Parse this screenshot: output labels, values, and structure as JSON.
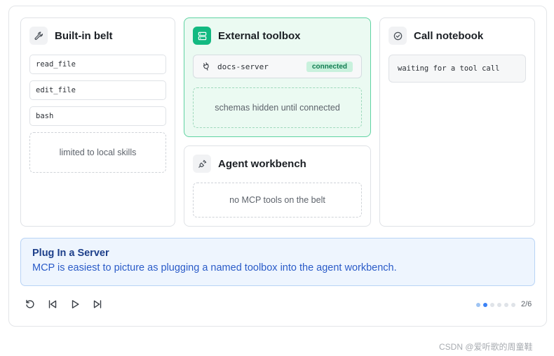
{
  "cards": {
    "belt": {
      "title": "Built-in belt",
      "icon": "wrench-icon",
      "tools": [
        "read_file",
        "edit_file",
        "bash"
      ],
      "note": "limited to local skills"
    },
    "toolbox": {
      "title": "External toolbox",
      "icon": "server-icon",
      "server_name": "docs-server",
      "server_icon": "plug-icon",
      "status": "connected",
      "note": "schemas hidden until connected",
      "accent": "#12b981"
    },
    "workbench": {
      "title": "Agent workbench",
      "icon": "unplugged-icon",
      "note": "no MCP tools on the belt"
    },
    "notebook": {
      "title": "Call notebook",
      "icon": "check-circle-icon",
      "status_text": "waiting for a tool call"
    }
  },
  "callout": {
    "title": "Plug In a Server",
    "body": "MCP is easiest to picture as plugging a named toolbox into the agent workbench."
  },
  "controls": {
    "buttons": [
      "restart-icon",
      "previous-icon",
      "play-icon",
      "next-icon"
    ]
  },
  "progress": {
    "current": 2,
    "total": 6,
    "label": "2/6"
  },
  "watermark": "CSDN @爱听歌的周童鞋"
}
